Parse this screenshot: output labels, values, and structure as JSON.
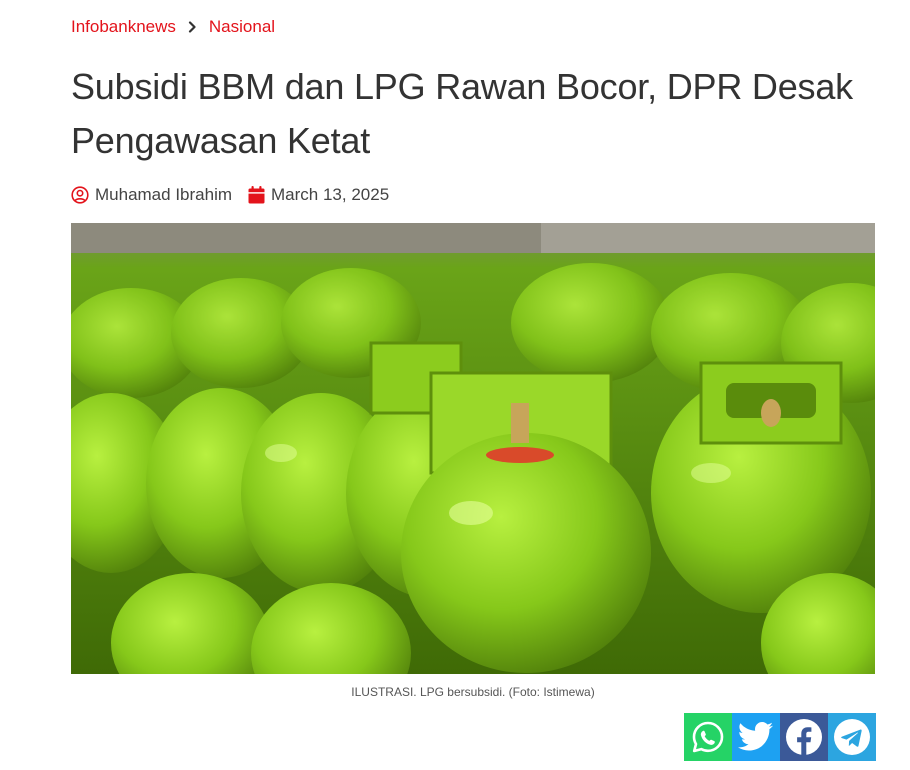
{
  "breadcrumb": {
    "home": "Infobanknews",
    "section": "Nasional"
  },
  "article": {
    "title": "Subsidi BBM dan LPG Rawan Bocor, DPR Desak Pengawasan Ketat",
    "author": "Muhamad Ibrahim",
    "date": "March 13, 2025",
    "image_caption": "ILUSTRASI. LPG bersubsidi. (Foto: Istimewa)"
  },
  "share": [
    {
      "name": "whatsapp",
      "color": "#25d366",
      "icon": "whatsapp-icon"
    },
    {
      "name": "twitter",
      "color": "#1da1f2",
      "icon": "twitter-icon"
    },
    {
      "name": "facebook",
      "color": "#3b5998",
      "icon": "facebook-icon"
    },
    {
      "name": "telegram",
      "color": "#2ca5e0",
      "icon": "telegram-icon"
    }
  ],
  "colors": {
    "accent": "#e3131b",
    "title": "#333333",
    "meta": "#444444"
  }
}
